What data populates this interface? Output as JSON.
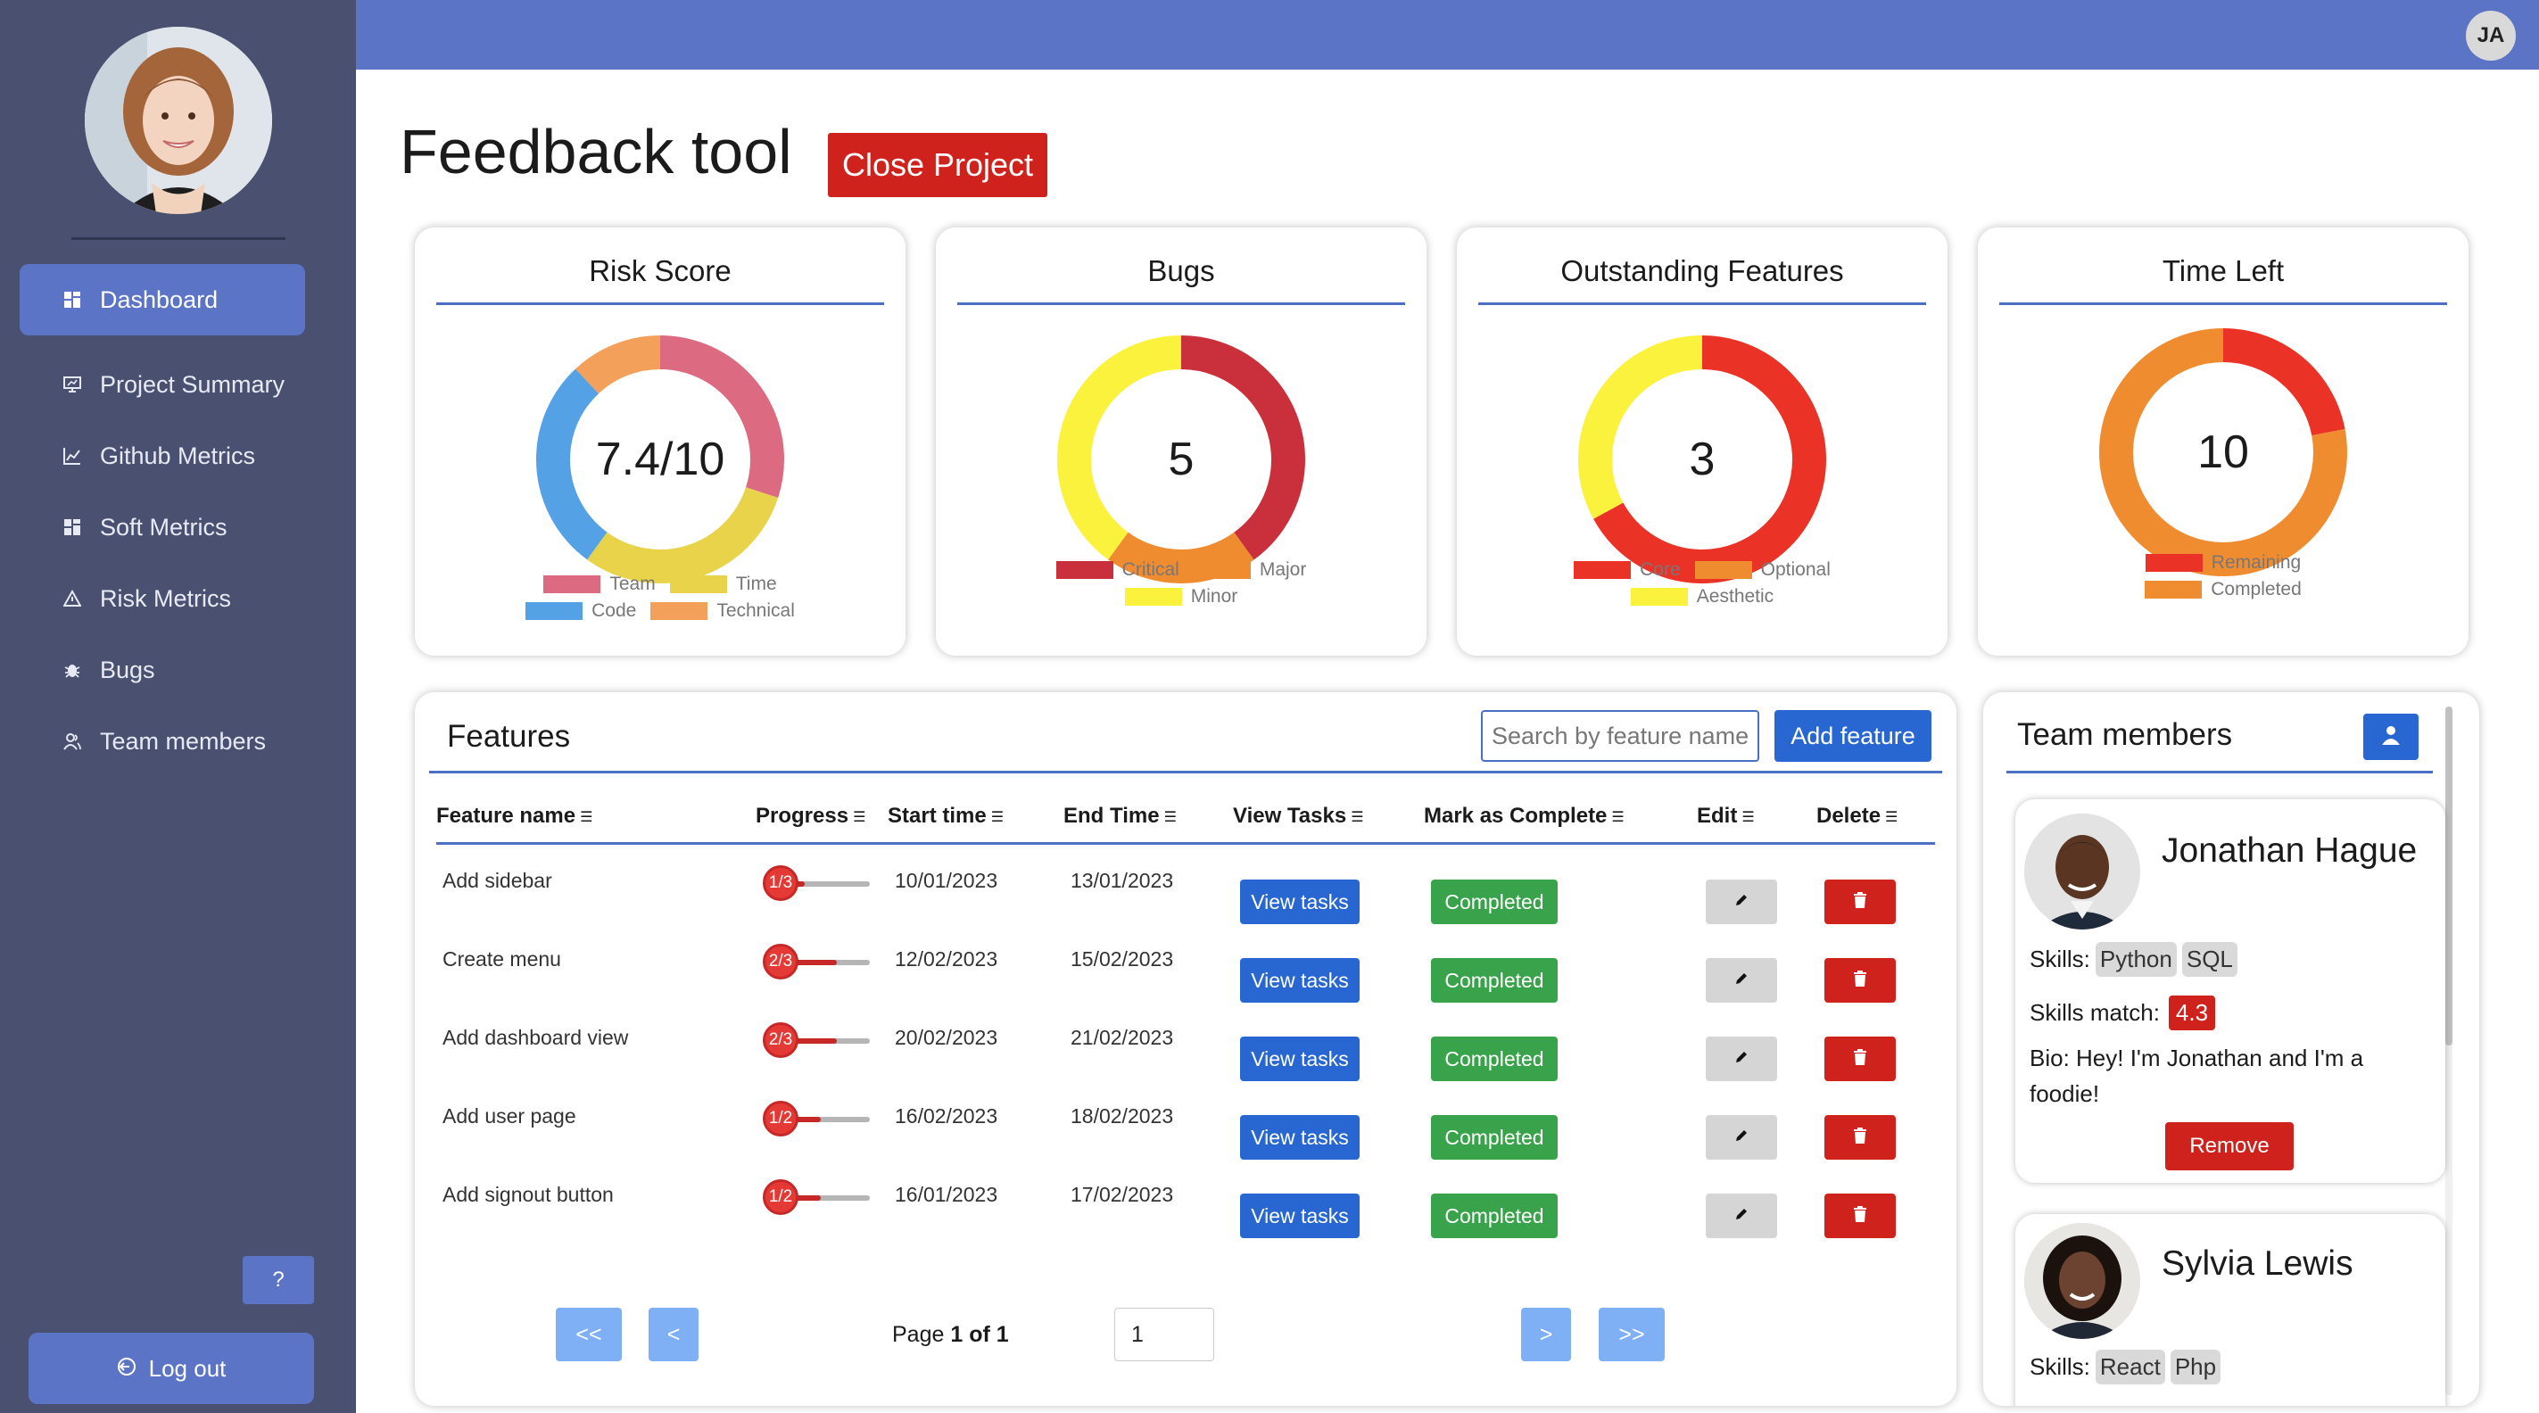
{
  "sidebar": {
    "items": [
      {
        "label": "Dashboard",
        "icon": "dashboard-icon",
        "active": true
      },
      {
        "label": "Project Summary",
        "icon": "presentation-icon"
      },
      {
        "label": "Github Metrics",
        "icon": "chart-line-icon"
      },
      {
        "label": "Soft Metrics",
        "icon": "grid-icon"
      },
      {
        "label": "Risk Metrics",
        "icon": "warning-icon"
      },
      {
        "label": "Bugs",
        "icon": "bug-icon"
      },
      {
        "label": "Team members",
        "icon": "users-icon"
      }
    ],
    "help_label": "?",
    "logout_label": "Log out"
  },
  "topbar": {
    "user_initials": "JA"
  },
  "page": {
    "title": "Feedback tool",
    "close_project_label": "Close Project"
  },
  "stats": [
    {
      "title": "Risk Score",
      "value": "7.4/10",
      "segments": [
        {
          "label": "Team",
          "color": "#dc6b82",
          "share": 0.3
        },
        {
          "label": "Time",
          "color": "#e8d34a",
          "share": 0.3
        },
        {
          "label": "Code",
          "color": "#55a1e6",
          "share": 0.28
        },
        {
          "label": "Technical",
          "color": "#f2a05a",
          "share": 0.12
        }
      ],
      "segment_order": [
        "Team",
        "Time",
        "Code",
        "Technical"
      ]
    },
    {
      "title": "Bugs",
      "value": "5",
      "segments": [
        {
          "label": "Critical",
          "color": "#c9303b",
          "share": 0.4
        },
        {
          "label": "Major",
          "color": "#f08c30",
          "share": 0.2
        },
        {
          "label": "Minor",
          "color": "#faf23c",
          "share": 0.4
        }
      ]
    },
    {
      "title": "Outstanding Features",
      "value": "3",
      "segments": [
        {
          "label": "Core",
          "color": "#ea3326",
          "share": 0.67
        },
        {
          "label": "Optional",
          "color": "#f08c30",
          "share": 0.0
        },
        {
          "label": "Aesthetic",
          "color": "#faf23c",
          "share": 0.33
        }
      ]
    },
    {
      "title": "Time Left",
      "value": "10",
      "segments": [
        {
          "label": "Remaining",
          "color": "#ea3326",
          "share": 0.22
        },
        {
          "label": "Completed",
          "color": "#f08c30",
          "share": 0.78
        }
      ]
    }
  ],
  "features": {
    "title": "Features",
    "search_placeholder": "Search by feature name",
    "add_label": "Add feature",
    "columns": [
      "Feature name",
      "Progress",
      "Start time",
      "End Time",
      "View Tasks",
      "Mark as Complete",
      "Edit",
      "Delete"
    ],
    "rows": [
      {
        "name": "Add sidebar",
        "progress": "1/3",
        "fraction": 0.333,
        "start": "10/01/2023",
        "end": "13/01/2023",
        "view": "View tasks",
        "status": "Completed"
      },
      {
        "name": "Create menu",
        "progress": "2/3",
        "fraction": 0.667,
        "start": "12/02/2023",
        "end": "15/02/2023",
        "view": "View tasks",
        "status": "Completed"
      },
      {
        "name": "Add dashboard view",
        "progress": "2/3",
        "fraction": 0.667,
        "start": "20/02/2023",
        "end": "21/02/2023",
        "view": "View tasks",
        "status": "Completed"
      },
      {
        "name": "Add user page",
        "progress": "1/2",
        "fraction": 0.5,
        "start": "16/02/2023",
        "end": "18/02/2023",
        "view": "View tasks",
        "status": "Completed"
      },
      {
        "name": "Add signout button",
        "progress": "1/2",
        "fraction": 0.5,
        "start": "16/01/2023",
        "end": "17/02/2023",
        "view": "View tasks",
        "status": "Completed"
      }
    ],
    "pager": {
      "first": "<<",
      "prev": "<",
      "next": ">",
      "last": ">>",
      "page_prefix": "Page ",
      "page_of": "1 of 1",
      "page_input": "1"
    }
  },
  "team": {
    "title": "Team members",
    "members": [
      {
        "name": "Jonathan Hague",
        "skills_label": "Skills:",
        "skills": [
          "Python",
          "SQL"
        ],
        "match_label": "Skills match:",
        "match": "4.3",
        "bio": "Bio: Hey! I'm Jonathan and I'm a foodie!",
        "remove_label": "Remove"
      },
      {
        "name": "Sylvia Lewis",
        "skills_label": "Skills:",
        "skills": [
          "React",
          "Php"
        ]
      }
    ]
  }
}
